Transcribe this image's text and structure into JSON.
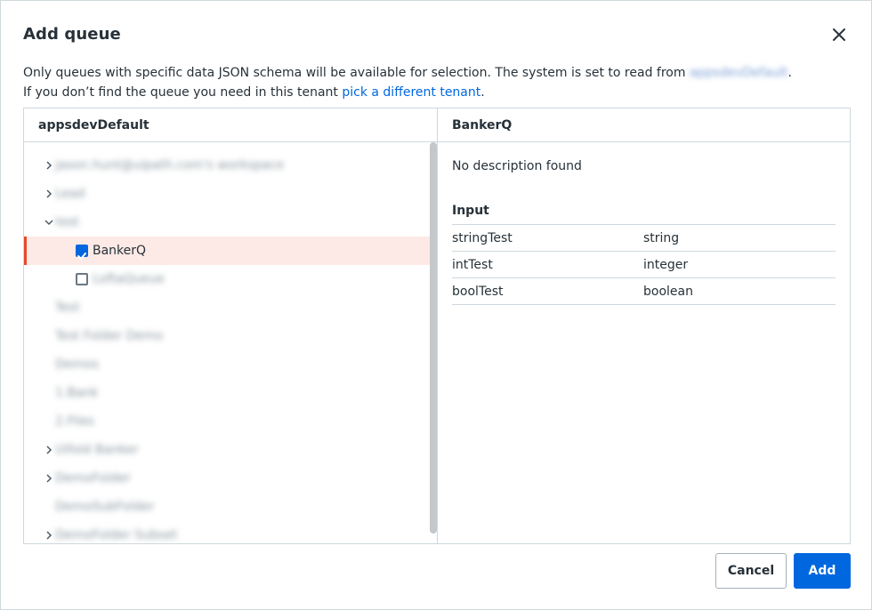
{
  "dialog": {
    "title": "Add queue",
    "info_line1_prefix": "Only queues with specific data JSON schema will be available for selection. The system is set to read from ",
    "info_line1_blurred": "appsdevDefault",
    "info_line1_suffix": ".",
    "info_line2_prefix": "If you don’t find the queue you need in this tenant ",
    "info_line2_link": "pick a different tenant",
    "info_line2_suffix": "."
  },
  "left_panel": {
    "header": "appsdevDefault",
    "tree": [
      {
        "label": "jason.hunt@uipath.com's workspace",
        "expand": "collapsed",
        "level": 0,
        "blurred": true
      },
      {
        "label": "Lead",
        "expand": "collapsed",
        "level": 0,
        "blurred": true
      },
      {
        "label": "test",
        "expand": "expanded",
        "level": 0,
        "blurred": true
      },
      {
        "label": "BankerQ",
        "checkbox": "checked",
        "level": 1,
        "blurred": false,
        "selected": true
      },
      {
        "label": "LoftaQueue",
        "checkbox": "unchecked",
        "level": 1,
        "blurred": true
      },
      {
        "label": "Test",
        "expand": "none",
        "level": 0,
        "blurred": true
      },
      {
        "label": "Test Folder Demo",
        "expand": "none",
        "level": 0,
        "blurred": true
      },
      {
        "label": "Demos",
        "expand": "none",
        "level": 0,
        "blurred": true
      },
      {
        "label": "1.Bank",
        "expand": "none",
        "level": 0,
        "blurred": true
      },
      {
        "label": "2.Files",
        "expand": "none",
        "level": 0,
        "blurred": true
      },
      {
        "label": "Uifold Banker",
        "expand": "collapsed",
        "level": 0,
        "blurred": true
      },
      {
        "label": "DemoFolder",
        "expand": "collapsed",
        "level": 0,
        "blurred": true
      },
      {
        "label": "DemoSubFolder",
        "expand": "none",
        "level": 0,
        "blurred": true
      },
      {
        "label": "DemoFolder Subset",
        "expand": "collapsed",
        "level": 0,
        "blurred": true
      }
    ]
  },
  "right_panel": {
    "header": "BankerQ",
    "description": "No description found",
    "input_title": "Input",
    "params": [
      {
        "name": "stringTest",
        "type": "string"
      },
      {
        "name": "intTest",
        "type": "integer"
      },
      {
        "name": "boolTest",
        "type": "boolean"
      }
    ]
  },
  "footer": {
    "cancel_label": "Cancel",
    "add_label": "Add"
  },
  "colors": {
    "primary": "#0067df",
    "selected_bg": "#fde9e5",
    "selected_accent": "#e8472a"
  },
  "icons": [
    "close-icon",
    "chevron-right-icon",
    "chevron-down-icon",
    "checkbox-checked-icon",
    "checkbox-unchecked-icon"
  ]
}
